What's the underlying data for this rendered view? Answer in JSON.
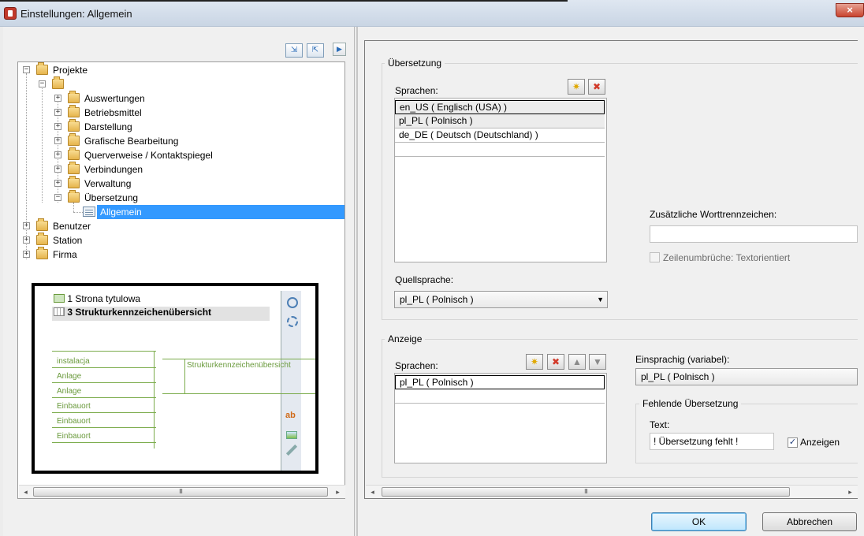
{
  "window": {
    "title": "Einstellungen: Allgemein",
    "close_label": "×"
  },
  "tree_toolbar": {
    "expand_icon": "expand-icon",
    "collapse_icon": "collapse-icon",
    "play_symbol": "▶"
  },
  "tree": {
    "projekte": "Projekte",
    "children": [
      "Auswertungen",
      "Betriebsmittel",
      "Darstellung",
      "Grafische Bearbeitung",
      "Querverweise / Kontaktspiegel",
      "Verbindungen",
      "Verwaltung",
      "Übersetzung"
    ],
    "selected_leaf": "Allgemein",
    "root_others": [
      "Benutzer",
      "Station",
      "Firma"
    ]
  },
  "preview": {
    "page1": "1 Strona tytulowa",
    "page3": "3 Strukturkennzeichenübersicht",
    "table_rows": [
      "instalacja",
      "Anlage",
      "Anlage",
      "Einbauort",
      "Einbauort",
      "Einbauort"
    ],
    "header_cell": "Strukturkennzeichenübersicht",
    "ab_label": "ab"
  },
  "scrollbar": {
    "thumb_grip": "III",
    "left_arrow": "◂",
    "right_arrow": "▸"
  },
  "uebersetzung": {
    "group_title": "Übersetzung",
    "sprachen_label": "Sprachen:",
    "languages": [
      "en_US ( Englisch (USA) )",
      "pl_PL ( Polnisch )",
      "de_DE ( Deutsch (Deutschland) )"
    ],
    "quellsprache_label": "Quellsprache:",
    "quellsprache_value": "pl_PL ( Polnisch )",
    "worttrennzeichen_label": "Zusätzliche Worttrennzeichen:",
    "worttrennzeichen_value": "",
    "zeilenumbrueche_label": "Zeilenumbrüche: Textorientiert"
  },
  "anzeige": {
    "group_title": "Anzeige",
    "sprachen_label": "Sprachen:",
    "languages": [
      "pl_PL ( Polnisch )"
    ],
    "einsprachig_label": "Einsprachig (variabel):",
    "einsprachig_value": "pl_PL ( Polnisch )",
    "fehlende_title": "Fehlende Übersetzung",
    "text_label": "Text:",
    "text_value": "! Übersetzung fehlt !",
    "anzeigen_label": "Anzeigen",
    "anzeigen_checked": "✓"
  },
  "icons": {
    "add": "✷",
    "delete": "✖",
    "up": "▲",
    "down": "▼",
    "dropdown": "▼"
  },
  "buttons": {
    "ok": "OK",
    "cancel": "Abbrechen"
  },
  "colors": {
    "selection": "#3399ff",
    "ok_button": "#bee6fd",
    "close_button": "#c9442e"
  }
}
